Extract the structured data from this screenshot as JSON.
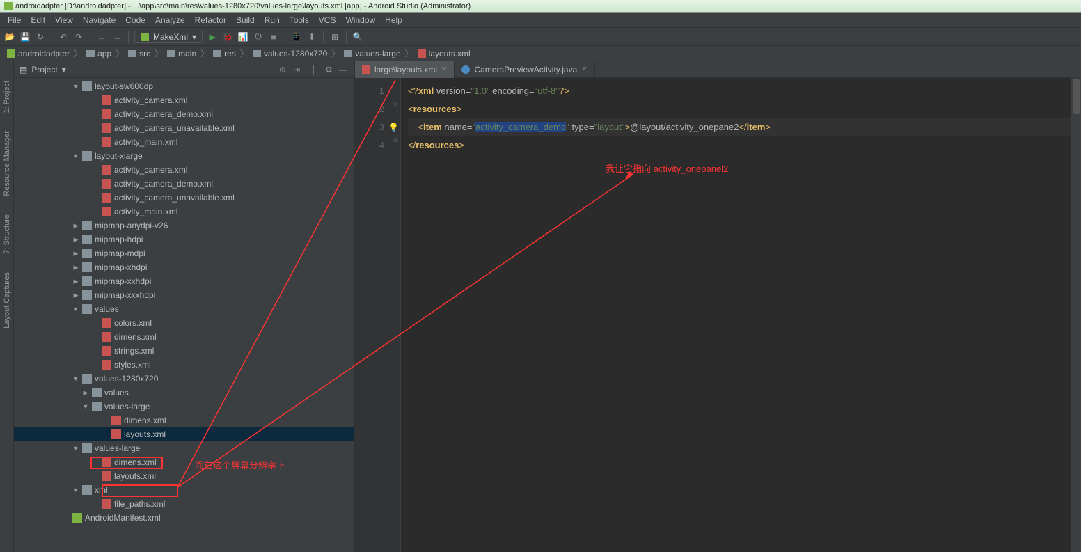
{
  "title": "androidadpter [D:\\androidadpter] - ...\\app\\src\\main\\res\\values-1280x720\\values-large\\layouts.xml [app] - Android Studio (Administrator)",
  "menu": [
    "File",
    "Edit",
    "View",
    "Navigate",
    "Code",
    "Analyze",
    "Refactor",
    "Build",
    "Run",
    "Tools",
    "VCS",
    "Window",
    "Help"
  ],
  "runConfig": "MakeXml",
  "breadcrumb": [
    "androidadpter",
    "app",
    "src",
    "main",
    "res",
    "values-1280x720",
    "values-large",
    "layouts.xml"
  ],
  "projectTitle": "Project",
  "tree": [
    {
      "indent": 6,
      "arrow": "down",
      "icon": "folder",
      "label": "layout-sw600dp"
    },
    {
      "indent": 8,
      "arrow": "none",
      "icon": "xml",
      "label": "activity_camera.xml"
    },
    {
      "indent": 8,
      "arrow": "none",
      "icon": "xml",
      "label": "activity_camera_demo.xml"
    },
    {
      "indent": 8,
      "arrow": "none",
      "icon": "xml",
      "label": "activity_camera_unavailable.xml"
    },
    {
      "indent": 8,
      "arrow": "none",
      "icon": "xml",
      "label": "activity_main.xml"
    },
    {
      "indent": 6,
      "arrow": "down",
      "icon": "folder",
      "label": "layout-xlarge"
    },
    {
      "indent": 8,
      "arrow": "none",
      "icon": "xml",
      "label": "activity_camera.xml"
    },
    {
      "indent": 8,
      "arrow": "none",
      "icon": "xml",
      "label": "activity_camera_demo.xml"
    },
    {
      "indent": 8,
      "arrow": "none",
      "icon": "xml",
      "label": "activity_camera_unavailable.xml"
    },
    {
      "indent": 8,
      "arrow": "none",
      "icon": "xml",
      "label": "activity_main.xml"
    },
    {
      "indent": 6,
      "arrow": "right",
      "icon": "folder",
      "label": "mipmap-anydpi-v26"
    },
    {
      "indent": 6,
      "arrow": "right",
      "icon": "folder",
      "label": "mipmap-hdpi"
    },
    {
      "indent": 6,
      "arrow": "right",
      "icon": "folder",
      "label": "mipmap-mdpi"
    },
    {
      "indent": 6,
      "arrow": "right",
      "icon": "folder",
      "label": "mipmap-xhdpi"
    },
    {
      "indent": 6,
      "arrow": "right",
      "icon": "folder",
      "label": "mipmap-xxhdpi"
    },
    {
      "indent": 6,
      "arrow": "right",
      "icon": "folder",
      "label": "mipmap-xxxhdpi"
    },
    {
      "indent": 6,
      "arrow": "down",
      "icon": "folder",
      "label": "values"
    },
    {
      "indent": 8,
      "arrow": "none",
      "icon": "xml",
      "label": "colors.xml"
    },
    {
      "indent": 8,
      "arrow": "none",
      "icon": "xml",
      "label": "dimens.xml"
    },
    {
      "indent": 8,
      "arrow": "none",
      "icon": "xml",
      "label": "strings.xml"
    },
    {
      "indent": 8,
      "arrow": "none",
      "icon": "xml",
      "label": "styles.xml"
    },
    {
      "indent": 6,
      "arrow": "down",
      "icon": "folder",
      "label": "values-1280x720"
    },
    {
      "indent": 7,
      "arrow": "right",
      "icon": "folder",
      "label": "values"
    },
    {
      "indent": 7,
      "arrow": "down",
      "icon": "folder",
      "label": "values-large"
    },
    {
      "indent": 9,
      "arrow": "none",
      "icon": "xml",
      "label": "dimens.xml"
    },
    {
      "indent": 9,
      "arrow": "none",
      "icon": "xml",
      "label": "layouts.xml",
      "selected": true
    },
    {
      "indent": 6,
      "arrow": "down",
      "icon": "folder",
      "label": "values-large",
      "boxed": true
    },
    {
      "indent": 8,
      "arrow": "none",
      "icon": "xml",
      "label": "dimens.xml"
    },
    {
      "indent": 8,
      "arrow": "none",
      "icon": "xml",
      "label": "layouts.xml",
      "boxed2": true
    },
    {
      "indent": 6,
      "arrow": "down",
      "icon": "folder",
      "label": "xml"
    },
    {
      "indent": 8,
      "arrow": "none",
      "icon": "xml",
      "label": "file_paths.xml"
    },
    {
      "indent": 5,
      "arrow": "none",
      "icon": "android",
      "label": "AndroidManifest.xml"
    }
  ],
  "editorTabs": [
    {
      "label": "large\\layouts.xml",
      "icon": "xml",
      "active": true
    },
    {
      "label": "CameraPreviewActivity.java",
      "icon": "java",
      "active": false
    }
  ],
  "code": {
    "lines": [
      "1",
      "2",
      "3",
      "4"
    ],
    "l1_decl": "<?xml version=\"1.0\" encoding=\"utf-8\"?>",
    "l2_open": "<resources>",
    "l3_itemOpen": "<item",
    "l3_nameAttr": "name=",
    "l3_nameVal": "\"activity_camera_demo\"",
    "l3_typeAttr": "type=",
    "l3_typeVal": "\"layout\"",
    "l3_text": "@layout/activity_onepane2",
    "l3_itemClose": "</item>",
    "l4_close": "</resources>"
  },
  "leftTabs": [
    "1: Project",
    "Resource Manager",
    "7: Structure",
    "Layout Captures"
  ],
  "annotations": {
    "a1": "我让它指向 activity_onepanel2",
    "a2": "而在这个屏幕分辨率下"
  }
}
